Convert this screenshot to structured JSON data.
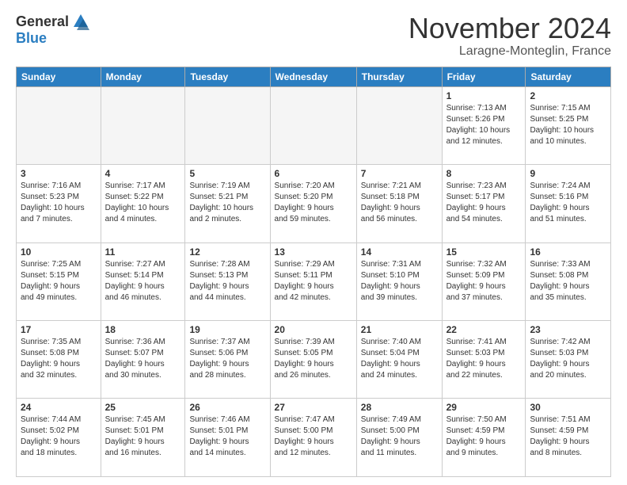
{
  "logo": {
    "general": "General",
    "blue": "Blue"
  },
  "header": {
    "month": "November 2024",
    "location": "Laragne-Monteglin, France"
  },
  "weekdays": [
    "Sunday",
    "Monday",
    "Tuesday",
    "Wednesday",
    "Thursday",
    "Friday",
    "Saturday"
  ],
  "weeks": [
    [
      {
        "day": "",
        "info": "",
        "empty": true
      },
      {
        "day": "",
        "info": "",
        "empty": true
      },
      {
        "day": "",
        "info": "",
        "empty": true
      },
      {
        "day": "",
        "info": "",
        "empty": true
      },
      {
        "day": "",
        "info": "",
        "empty": true
      },
      {
        "day": "1",
        "info": "Sunrise: 7:13 AM\nSunset: 5:26 PM\nDaylight: 10 hours\nand 12 minutes."
      },
      {
        "day": "2",
        "info": "Sunrise: 7:15 AM\nSunset: 5:25 PM\nDaylight: 10 hours\nand 10 minutes."
      }
    ],
    [
      {
        "day": "3",
        "info": "Sunrise: 7:16 AM\nSunset: 5:23 PM\nDaylight: 10 hours\nand 7 minutes."
      },
      {
        "day": "4",
        "info": "Sunrise: 7:17 AM\nSunset: 5:22 PM\nDaylight: 10 hours\nand 4 minutes."
      },
      {
        "day": "5",
        "info": "Sunrise: 7:19 AM\nSunset: 5:21 PM\nDaylight: 10 hours\nand 2 minutes."
      },
      {
        "day": "6",
        "info": "Sunrise: 7:20 AM\nSunset: 5:20 PM\nDaylight: 9 hours\nand 59 minutes."
      },
      {
        "day": "7",
        "info": "Sunrise: 7:21 AM\nSunset: 5:18 PM\nDaylight: 9 hours\nand 56 minutes."
      },
      {
        "day": "8",
        "info": "Sunrise: 7:23 AM\nSunset: 5:17 PM\nDaylight: 9 hours\nand 54 minutes."
      },
      {
        "day": "9",
        "info": "Sunrise: 7:24 AM\nSunset: 5:16 PM\nDaylight: 9 hours\nand 51 minutes."
      }
    ],
    [
      {
        "day": "10",
        "info": "Sunrise: 7:25 AM\nSunset: 5:15 PM\nDaylight: 9 hours\nand 49 minutes."
      },
      {
        "day": "11",
        "info": "Sunrise: 7:27 AM\nSunset: 5:14 PM\nDaylight: 9 hours\nand 46 minutes."
      },
      {
        "day": "12",
        "info": "Sunrise: 7:28 AM\nSunset: 5:13 PM\nDaylight: 9 hours\nand 44 minutes."
      },
      {
        "day": "13",
        "info": "Sunrise: 7:29 AM\nSunset: 5:11 PM\nDaylight: 9 hours\nand 42 minutes."
      },
      {
        "day": "14",
        "info": "Sunrise: 7:31 AM\nSunset: 5:10 PM\nDaylight: 9 hours\nand 39 minutes."
      },
      {
        "day": "15",
        "info": "Sunrise: 7:32 AM\nSunset: 5:09 PM\nDaylight: 9 hours\nand 37 minutes."
      },
      {
        "day": "16",
        "info": "Sunrise: 7:33 AM\nSunset: 5:08 PM\nDaylight: 9 hours\nand 35 minutes."
      }
    ],
    [
      {
        "day": "17",
        "info": "Sunrise: 7:35 AM\nSunset: 5:08 PM\nDaylight: 9 hours\nand 32 minutes."
      },
      {
        "day": "18",
        "info": "Sunrise: 7:36 AM\nSunset: 5:07 PM\nDaylight: 9 hours\nand 30 minutes."
      },
      {
        "day": "19",
        "info": "Sunrise: 7:37 AM\nSunset: 5:06 PM\nDaylight: 9 hours\nand 28 minutes."
      },
      {
        "day": "20",
        "info": "Sunrise: 7:39 AM\nSunset: 5:05 PM\nDaylight: 9 hours\nand 26 minutes."
      },
      {
        "day": "21",
        "info": "Sunrise: 7:40 AM\nSunset: 5:04 PM\nDaylight: 9 hours\nand 24 minutes."
      },
      {
        "day": "22",
        "info": "Sunrise: 7:41 AM\nSunset: 5:03 PM\nDaylight: 9 hours\nand 22 minutes."
      },
      {
        "day": "23",
        "info": "Sunrise: 7:42 AM\nSunset: 5:03 PM\nDaylight: 9 hours\nand 20 minutes."
      }
    ],
    [
      {
        "day": "24",
        "info": "Sunrise: 7:44 AM\nSunset: 5:02 PM\nDaylight: 9 hours\nand 18 minutes."
      },
      {
        "day": "25",
        "info": "Sunrise: 7:45 AM\nSunset: 5:01 PM\nDaylight: 9 hours\nand 16 minutes."
      },
      {
        "day": "26",
        "info": "Sunrise: 7:46 AM\nSunset: 5:01 PM\nDaylight: 9 hours\nand 14 minutes."
      },
      {
        "day": "27",
        "info": "Sunrise: 7:47 AM\nSunset: 5:00 PM\nDaylight: 9 hours\nand 12 minutes."
      },
      {
        "day": "28",
        "info": "Sunrise: 7:49 AM\nSunset: 5:00 PM\nDaylight: 9 hours\nand 11 minutes."
      },
      {
        "day": "29",
        "info": "Sunrise: 7:50 AM\nSunset: 4:59 PM\nDaylight: 9 hours\nand 9 minutes."
      },
      {
        "day": "30",
        "info": "Sunrise: 7:51 AM\nSunset: 4:59 PM\nDaylight: 9 hours\nand 8 minutes."
      }
    ]
  ]
}
